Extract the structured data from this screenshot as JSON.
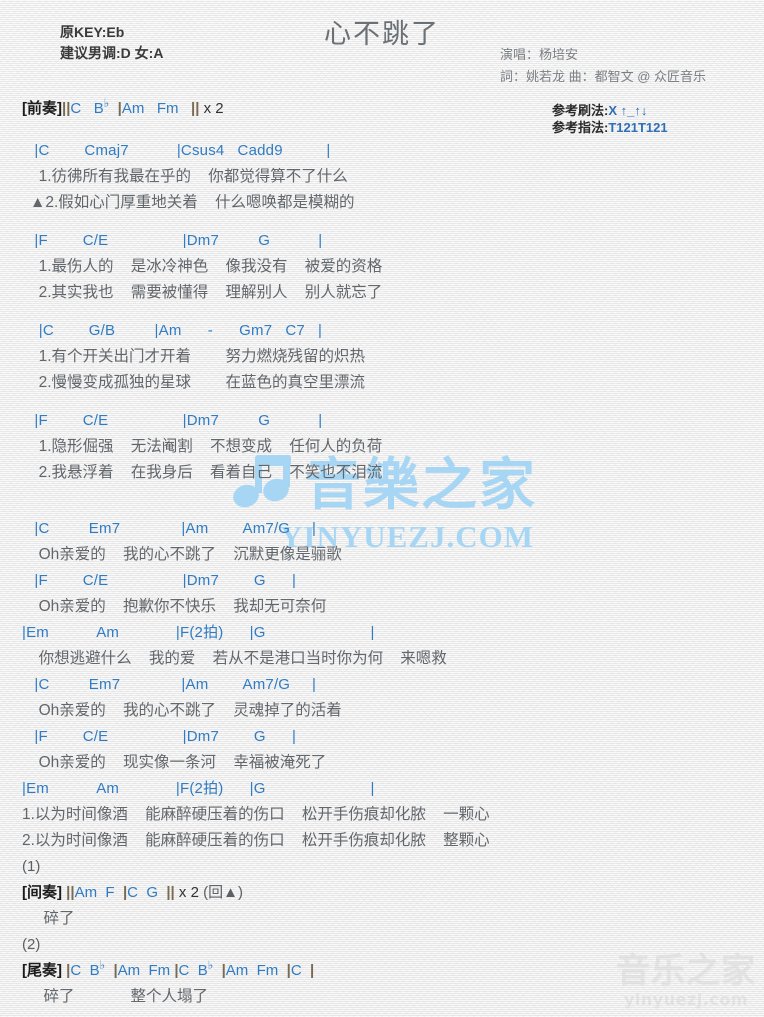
{
  "header": {
    "orig_key": "原KEY:Eb",
    "suggested_key": "建议男调:D 女:A",
    "title": "心不跳了",
    "singer": "演唱：杨培安",
    "writers": "詞：姚若龙  曲：都智文 @ 众匠音乐",
    "strum_label": "参考刷法:",
    "strum_pattern": "X ↑_↑↓",
    "finger_label": "参考指法:",
    "finger_pattern": "T121T121"
  },
  "sections": {
    "prelude_tag": "[前奏]",
    "interlude_tag": "[间奏]",
    "outro_tag": "[尾奏]"
  },
  "prelude": {
    "bars": "||",
    "c": "C",
    "bb": "B",
    "bb_flat": "♭",
    "am": "Am",
    "fm": "Fm",
    "bar_mid": "|",
    "bar_end": "||",
    "repeat": "x 2"
  },
  "verse": [
    {
      "chords": " |C        Cmaj7           |Csus4   Cadd9          |",
      "lyrics": [
        "  1.彷彿所有我最在乎的    你都觉得算不了什么",
        "▲2.假如心门厚重地关着    什么嗯唤都是模糊的"
      ]
    },
    {
      "chords": " |F        C/E                 |Dm7         G           |",
      "lyrics": [
        "  1.最伤人的    是冰冷神色    像我没有    被爱的资格",
        "  2.其实我也    需要被懂得    理解别人    别人就忘了"
      ]
    },
    {
      "chords": "  |C        G/B         |Am      -      Gm7   C7   |",
      "lyrics": [
        "  1.有个开关出门才开着        努力燃烧残留的炽热",
        "  2.慢慢变成孤独的星球        在蓝色的真空里漂流"
      ]
    },
    {
      "chords": " |F        C/E                 |Dm7         G           |",
      "lyrics": [
        "  1.隐形倔强    无法阉割    不想变成    任何人的负荷",
        "  2.我悬浮着    在我身后    看着自己    不笑也不泪流"
      ]
    }
  ],
  "chorus1": [
    {
      "chords": " |C         Em7              |Am        Am7/G     |",
      "lyrics": [
        "  Oh亲爱的    我的心不跳了    沉默更像是骊歌"
      ]
    },
    {
      "chords": " |F        C/E                 |Dm7        G      |",
      "lyrics": [
        "  Oh亲爱的    抱歉你不快乐    我却无可奈何"
      ]
    },
    {
      "chords": "|Em           Am             |F(2拍)      |G                        |",
      "lyrics": [
        "  你想逃避什么    我的爱    若从不是港口当时你为何    来嗯救"
      ]
    }
  ],
  "chorus2": [
    {
      "chords": " |C         Em7              |Am        Am7/G     |",
      "lyrics": [
        "  Oh亲爱的    我的心不跳了    灵魂掉了的活着"
      ]
    },
    {
      "chords": " |F        C/E                 |Dm7        G      |",
      "lyrics": [
        "  Oh亲爱的    现实像一条河    幸福被淹死了"
      ]
    },
    {
      "chords": "|Em           Am             |F(2拍)      |G                        |",
      "lyrics": [
        "1.以为时间像酒    能麻醉硬压着的伤口    松开手伤痕却化脓    一颗心",
        "2.以为时间像酒    能麻醉硬压着的伤口    松开手伤痕却化脓    整颗心"
      ]
    }
  ],
  "ending": {
    "mark1": "(1)",
    "interlude_bars": "||",
    "interlude_am": "Am",
    "interlude_f": "F",
    "interlude_bar_mid": "|",
    "interlude_c": "C",
    "interlude_g": "G",
    "interlude_bar_end": "||",
    "interlude_repeat": "x 2",
    "interlude_note": "(回▲)",
    "interlude_lyric": "     碎了",
    "mark2": "(2)",
    "outro_bar1": "|",
    "outro_c1": "C",
    "outro_bb1": "B",
    "outro_flat1": "♭",
    "outro_bar2": "|",
    "outro_am1": "Am",
    "outro_fm1": "Fm",
    "outro_bar3": "|",
    "outro_c2": "C",
    "outro_bb2": "B",
    "outro_flat2": "♭",
    "outro_bar4": "|",
    "outro_am2": "Am",
    "outro_fm2": "Fm",
    "outro_bar5": "|",
    "outro_c3": "C",
    "outro_bar6": "|",
    "outro_lyric": "     碎了             整个人塌了"
  },
  "watermark": {
    "center_cn": "音樂之家",
    "center_url": "YINYUEZJ.COM",
    "corner_cn": "音乐之家",
    "corner_url": "yinyuezj.com"
  },
  "colors": {
    "chord_blue": "#2f7cc4",
    "lyric_gray": "#62676c",
    "bar_brown": "#7a6a52",
    "watermark_blue": "#a7d6f4"
  }
}
